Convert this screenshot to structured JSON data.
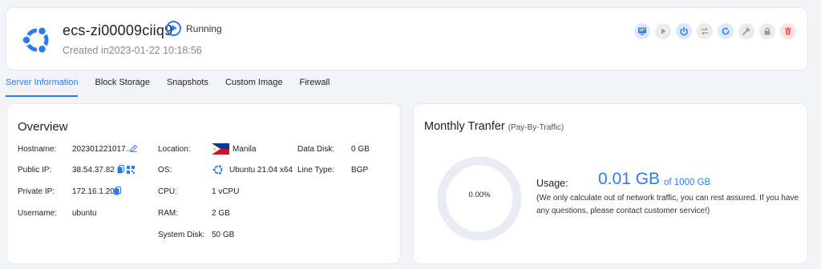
{
  "server": {
    "name": "ecs-zi00009ciiq9",
    "status": "Running",
    "created": "Created in2023-01-22 10:18:56",
    "os_icon": "ubuntu-logo"
  },
  "toolbar": [
    {
      "name": "console-icon",
      "tone": "blue"
    },
    {
      "name": "start-icon",
      "tone": "gray"
    },
    {
      "name": "power-icon",
      "tone": "blue"
    },
    {
      "name": "switch-icon",
      "tone": "gray"
    },
    {
      "name": "restart-icon",
      "tone": "blue"
    },
    {
      "name": "settings-wrench-icon",
      "tone": "gray"
    },
    {
      "name": "lock-icon",
      "tone": "gray"
    },
    {
      "name": "delete-icon",
      "tone": "red"
    }
  ],
  "tabs": [
    "Server Information",
    "Block Storage",
    "Snapshots",
    "Custom Image",
    "Firewall"
  ],
  "overview": {
    "title": "Overview",
    "hostname_label": "Hostname:",
    "hostname": "202301221017...",
    "public_ip_label": "Public IP:",
    "public_ip": "38.54.37.82",
    "private_ip_label": "Private IP:",
    "private_ip": "172.16.1.201",
    "username_label": "Username:",
    "username": "ubuntu",
    "location_label": "Location:",
    "location": "Manila",
    "os_label": "OS:",
    "os": "Ubuntu 21.04 x64",
    "cpu_label": "CPU:",
    "cpu": "1 vCPU",
    "ram_label": "RAM:",
    "ram": "2 GB",
    "system_disk_label": "System Disk:",
    "system_disk": "50 GB",
    "data_disk_label": "Data Disk:",
    "data_disk": "0 GB",
    "line_type_label": "Line Type:",
    "line_type": "BGP"
  },
  "monthly": {
    "title": "Monthly Tranfer",
    "subtitle": "(Pay-By-Traffic)",
    "percent": "0.00%",
    "usage_label": "Usage:",
    "usage_value": "0.01 GB",
    "usage_total": "of 1000 GB",
    "note": "(We only calculate out of network traffic, you can rest assured. If you have any questions, please contact customer service!)"
  },
  "colors": {
    "accent": "#2b7bf0",
    "danger": "#e84c4c",
    "donut_track": "#e8edf5"
  }
}
